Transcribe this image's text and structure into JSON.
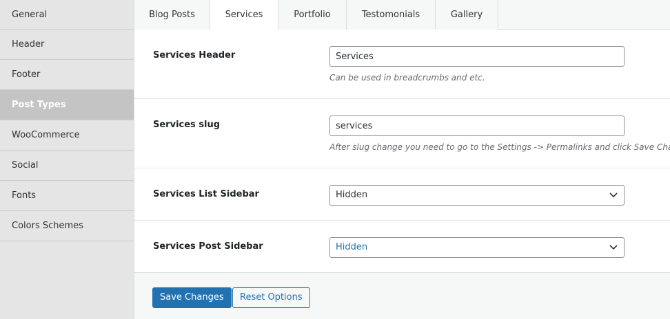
{
  "sidebar": {
    "items": [
      {
        "label": "General"
      },
      {
        "label": "Header"
      },
      {
        "label": "Footer"
      },
      {
        "label": "Post Types"
      },
      {
        "label": "WooCommerce"
      },
      {
        "label": "Social"
      },
      {
        "label": "Fonts"
      },
      {
        "label": "Colors Schemes"
      }
    ],
    "active": "Post Types"
  },
  "tabs": [
    {
      "label": "Blog Posts"
    },
    {
      "label": "Services"
    },
    {
      "label": "Portfolio"
    },
    {
      "label": "Testomonials"
    },
    {
      "label": "Gallery"
    }
  ],
  "active_tab": "Services",
  "fields": {
    "header": {
      "label": "Services Header",
      "value": "Services",
      "description": "Can be used in breadcrumbs and etc."
    },
    "slug": {
      "label": "Services slug",
      "value": "services",
      "description": "After slug change you need to go to the Settings -> Permalinks and click Save Changes."
    },
    "list_sidebar": {
      "label": "Services List Sidebar",
      "value": "Hidden"
    },
    "post_sidebar": {
      "label": "Services Post Sidebar",
      "value": "Hidden"
    }
  },
  "buttons": {
    "save": "Save Changes",
    "reset": "Reset Options"
  },
  "colors": {
    "accent": "#2271b1",
    "sidebar_active": "#c4c4c4"
  }
}
